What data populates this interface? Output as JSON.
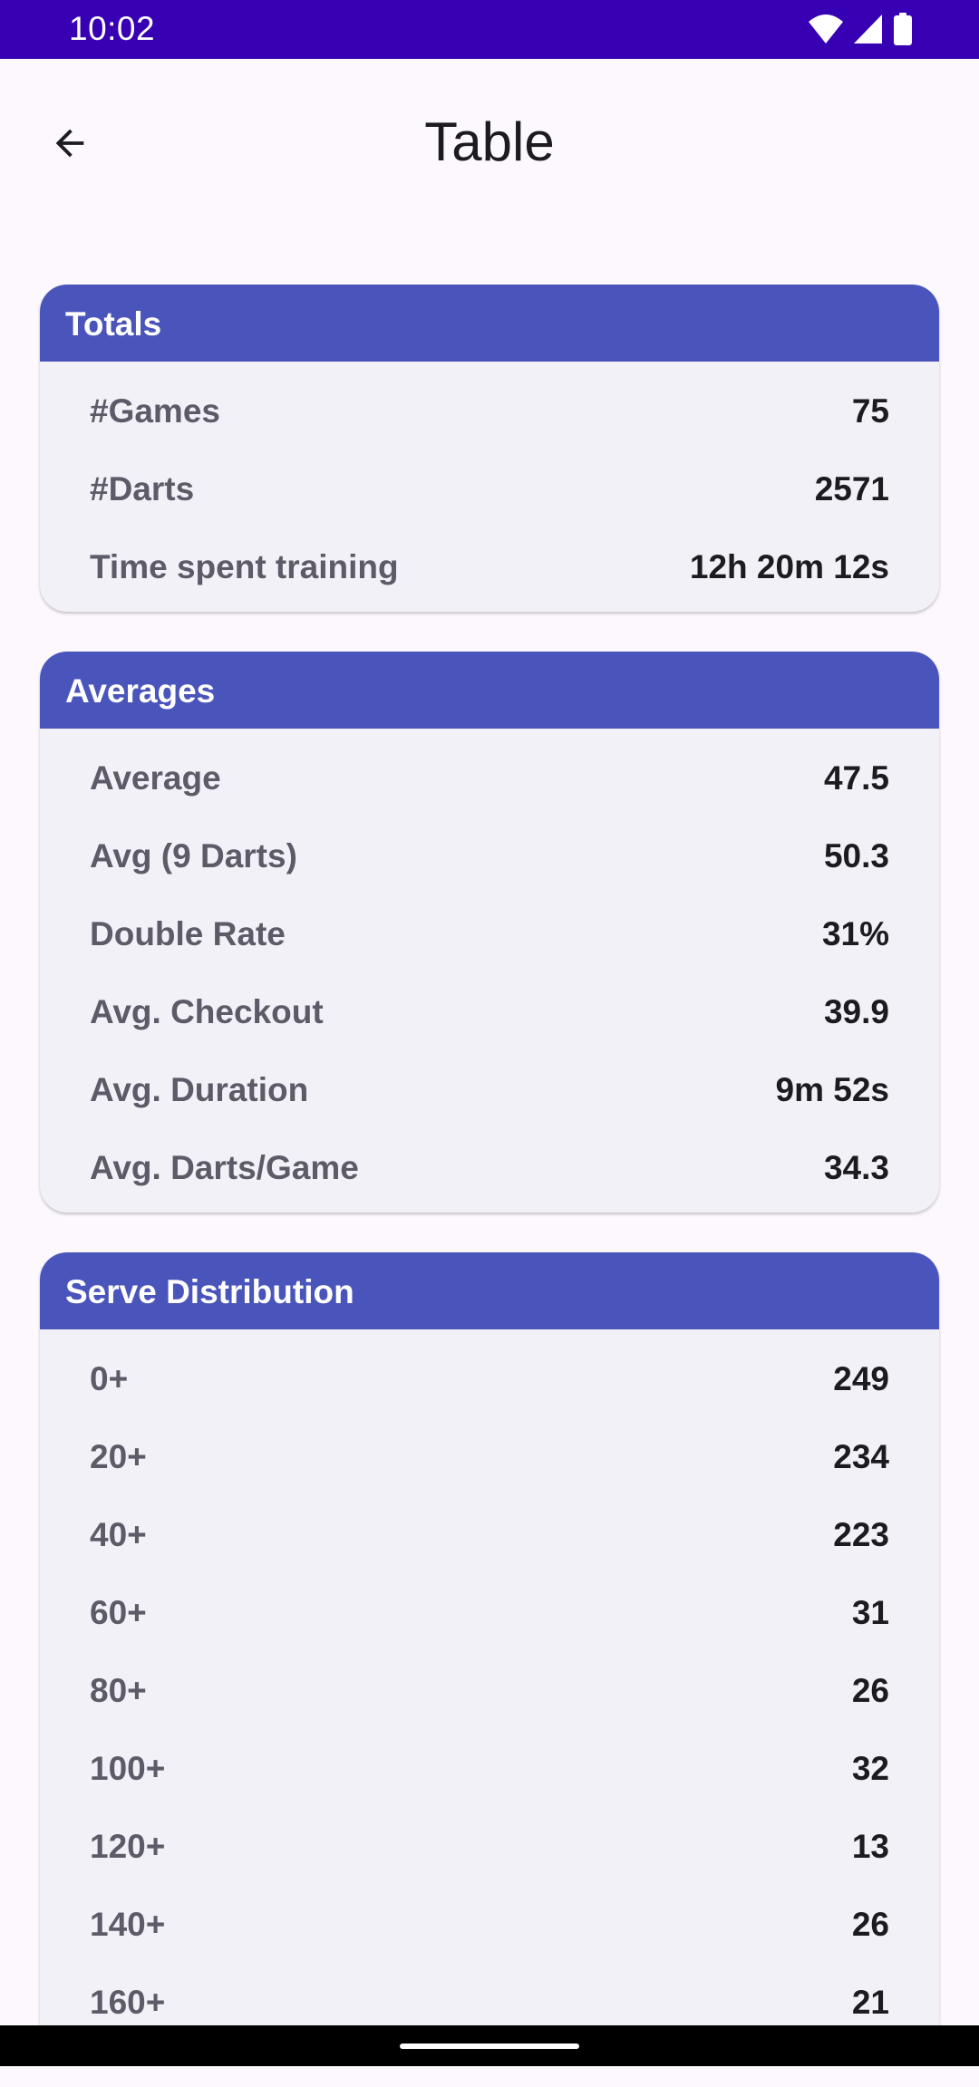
{
  "status_bar": {
    "time": "10:02",
    "background": "#3700b3"
  },
  "app_bar": {
    "back_icon": "arrow-back-icon",
    "title": "Table"
  },
  "colors": {
    "card_header": "#4a55bb",
    "card_body": "#f3f1f8",
    "page_background": "#fdf8fd"
  },
  "sections": [
    {
      "title": "Totals",
      "rows": [
        {
          "label": "#Games",
          "value": "75"
        },
        {
          "label": "#Darts",
          "value": "2571"
        },
        {
          "label": "Time spent training",
          "value": "12h 20m 12s"
        }
      ]
    },
    {
      "title": "Averages",
      "rows": [
        {
          "label": "Average",
          "value": "47.5"
        },
        {
          "label": "Avg (9 Darts)",
          "value": "50.3"
        },
        {
          "label": "Double Rate",
          "value": "31%"
        },
        {
          "label": "Avg. Checkout",
          "value": "39.9"
        },
        {
          "label": "Avg. Duration",
          "value": "9m 52s"
        },
        {
          "label": "Avg. Darts/Game",
          "value": "34.3"
        }
      ]
    },
    {
      "title": "Serve Distribution",
      "rows": [
        {
          "label": "0+",
          "value": "249"
        },
        {
          "label": "20+",
          "value": "234"
        },
        {
          "label": "40+",
          "value": "223"
        },
        {
          "label": "60+",
          "value": "31"
        },
        {
          "label": "80+",
          "value": "26"
        },
        {
          "label": "100+",
          "value": "32"
        },
        {
          "label": "120+",
          "value": "13"
        },
        {
          "label": "140+",
          "value": "26"
        },
        {
          "label": "160+",
          "value": "21"
        }
      ]
    }
  ]
}
